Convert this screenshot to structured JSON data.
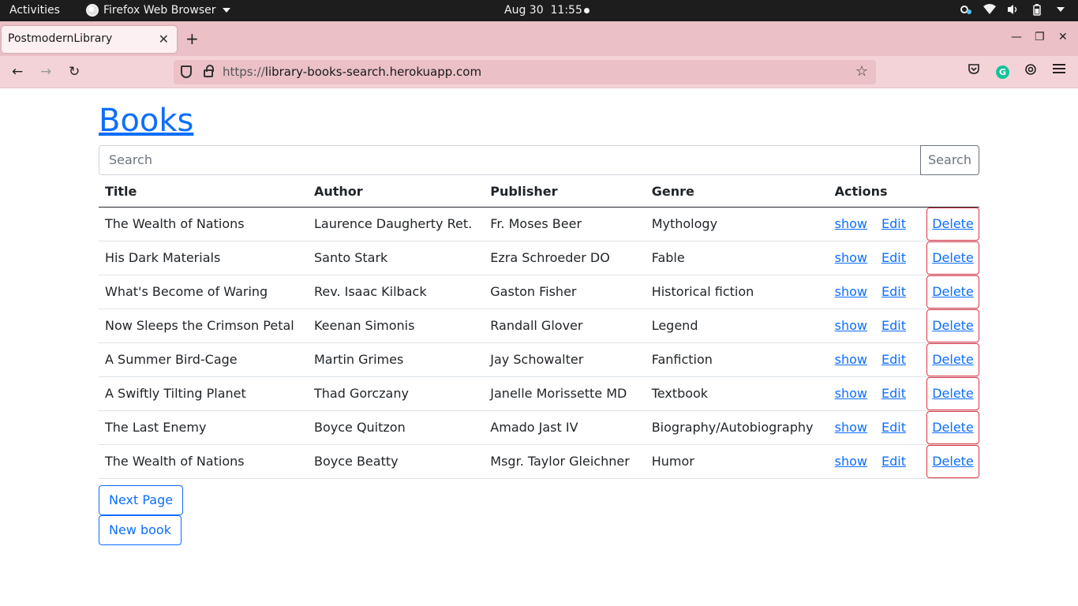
{
  "system_bar": {
    "activities": "Activities",
    "app_name": "Firefox Web Browser",
    "date": "Aug 30",
    "time": "11:55"
  },
  "browser": {
    "tab_title": "PostmodernLibrary",
    "url_scheme": "https://",
    "url_host": "library-books-search.herokuapp.com"
  },
  "page": {
    "heading": "Books",
    "search_placeholder": "Search",
    "search_button": "Search",
    "columns": [
      "Title",
      "Author",
      "Publisher",
      "Genre",
      "Actions"
    ],
    "rows": [
      {
        "title": "The Wealth of Nations",
        "author": "Laurence Daugherty Ret.",
        "publisher": "Fr. Moses Beer",
        "genre": "Mythology"
      },
      {
        "title": "His Dark Materials",
        "author": "Santo Stark",
        "publisher": "Ezra Schroeder DO",
        "genre": "Fable"
      },
      {
        "title": "What's Become of Waring",
        "author": "Rev. Isaac Kilback",
        "publisher": "Gaston Fisher",
        "genre": "Historical fiction"
      },
      {
        "title": "Now Sleeps the Crimson Petal",
        "author": "Keenan Simonis",
        "publisher": "Randall Glover",
        "genre": "Legend"
      },
      {
        "title": "A Summer Bird-Cage",
        "author": "Martin Grimes",
        "publisher": "Jay Schowalter",
        "genre": "Fanfiction"
      },
      {
        "title": "A Swiftly Tilting Planet",
        "author": "Thad Gorczany",
        "publisher": "Janelle Morissette MD",
        "genre": "Textbook"
      },
      {
        "title": "The Last Enemy",
        "author": "Boyce Quitzon",
        "publisher": "Amado Jast IV",
        "genre": "Biography/Autobiography"
      },
      {
        "title": "The Wealth of Nations",
        "author": "Boyce Beatty",
        "publisher": "Msgr. Taylor Gleichner",
        "genre": "Humor"
      }
    ],
    "actions": {
      "show": "show",
      "edit": "Edit",
      "delete": "Delete"
    },
    "next_page": "Next Page",
    "new_book": "New book"
  }
}
